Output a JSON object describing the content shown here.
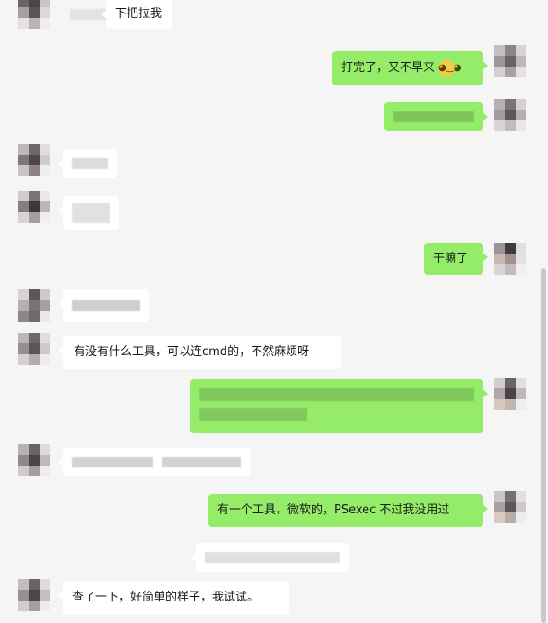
{
  "messages": [
    {
      "side": "in",
      "text": "下把拉我"
    },
    {
      "side": "out",
      "text": "打完了，又不早来",
      "emoji": "nerd-face-icon"
    },
    {
      "side": "out",
      "text": ""
    },
    {
      "side": "in",
      "text": ""
    },
    {
      "side": "in",
      "text": ""
    },
    {
      "side": "out",
      "text": "干嘛了"
    },
    {
      "side": "in",
      "text": ""
    },
    {
      "side": "in",
      "text": "有没有什么工具，可以连cmd的，不然麻烦呀"
    },
    {
      "side": "out",
      "text": ""
    },
    {
      "side": "in",
      "text": ""
    },
    {
      "side": "out",
      "text": "有一个工具，微软的，PSexec 不过我没用过"
    },
    {
      "side": "in",
      "text": ""
    },
    {
      "side": "in",
      "text": "查了一下，好简单的样子，我试试。"
    }
  ],
  "colors": {
    "background": "#f5f5f5",
    "outgoing_bubble": "#95ec69",
    "incoming_bubble": "#ffffff"
  }
}
